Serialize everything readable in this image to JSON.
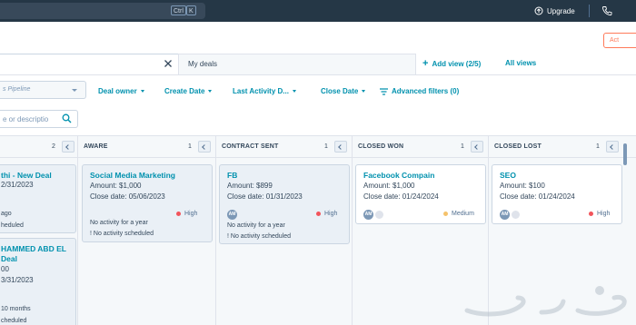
{
  "topbar": {
    "shortcut_keys": [
      "Ctrl",
      "K"
    ],
    "upgrade_label": "Upgrade"
  },
  "view": {
    "current_tab": "My deals",
    "add_view": "Add view (2/5)",
    "all_views": "All views"
  },
  "filters": {
    "pipeline_value": "s Pipeline",
    "deal_owner": "Deal owner",
    "create_date": "Create Date",
    "last_activity": "Last Activity D...",
    "close_date": "Close Date",
    "advanced": "Advanced filters (0)"
  },
  "search": {
    "placeholder": "e or descriptio"
  },
  "colors": {
    "accent": "#0091ae",
    "topbar": "#253746",
    "high": "#f2545b",
    "medium": "#f5c26b",
    "upgrade_cta": "#ff7a59"
  },
  "edge_button_label": "Act",
  "columns": [
    {
      "id": "first",
      "title": "",
      "count": "2",
      "cards": [
        {
          "name": "thi - New Deal",
          "close": "2/31/2023",
          "activity_ago": "ago",
          "scheduled": "heduled"
        },
        {
          "name_line1": "HAMMED ABD EL",
          "name_line2": "Deal",
          "amount": "00",
          "close": "3/31/2023",
          "activity_ago": "10 months",
          "scheduled": "cheduled"
        }
      ]
    },
    {
      "id": "aware",
      "title": "AWARE",
      "count": "1",
      "cards": [
        {
          "name": "Social Media Marketing",
          "amount": "Amount: $1,000",
          "close": "Close date: 05/06/2023",
          "priority": "High",
          "activity": "No activity for a year",
          "scheduled": "! No activity scheduled"
        }
      ]
    },
    {
      "id": "contract-sent",
      "title": "CONTRACT SENT",
      "count": "1",
      "cards": [
        {
          "name": "FB",
          "amount": "Amount: $899",
          "close": "Close date: 01/31/2023",
          "avatar": "AM",
          "priority": "High",
          "activity": "No activity for a year",
          "scheduled": "! No activity scheduled"
        }
      ]
    },
    {
      "id": "closed-won",
      "title": "CLOSED WON",
      "count": "1",
      "cards": [
        {
          "name": "Facebook Compain",
          "amount": "Amount: $1,000",
          "close": "Close date: 01/24/2024",
          "avatar": "AM",
          "priority": "Medium"
        }
      ]
    },
    {
      "id": "closed-lost",
      "title": "CLOSED LOST",
      "count": "1",
      "cards": [
        {
          "name": "SEO",
          "amount": "Amount: $100",
          "close": "Close date: 01/24/2024",
          "avatar": "AM",
          "priority": "High"
        }
      ]
    }
  ]
}
